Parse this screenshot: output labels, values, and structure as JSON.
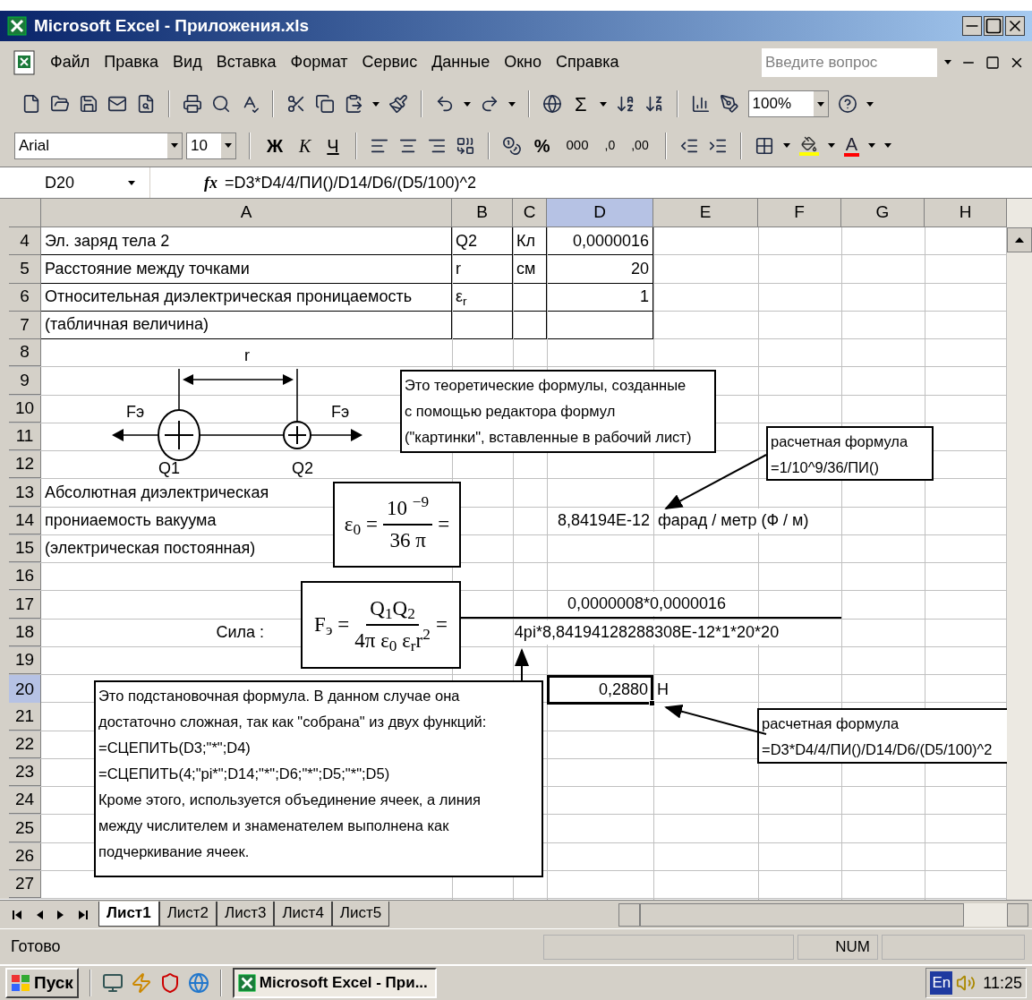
{
  "window": {
    "title": "Microsoft Excel - Приложения.xls"
  },
  "menu": [
    "Файл",
    "Правка",
    "Вид",
    "Вставка",
    "Формат",
    "Сервис",
    "Данные",
    "Окно",
    "Справка"
  ],
  "question_field": {
    "placeholder": "Введите вопрос"
  },
  "standard_toolbar": {
    "sum": "Σ",
    "zoom": "100%"
  },
  "format_toolbar": {
    "font": "Arial",
    "size": "10",
    "bold": "Ж",
    "italic": "К",
    "underline": "Ч",
    "percent": "%",
    "thousands": "000",
    "decimals": [
      ",0",
      ",00"
    ],
    "font_color": "A"
  },
  "formula_bar": {
    "name_box": "D20",
    "fx": "fx",
    "formula": "=D3*D4/4/ПИ()/D14/D6/(D5/100)^2"
  },
  "columns": [
    {
      "label": "A",
      "selected": false
    },
    {
      "label": "B",
      "selected": false
    },
    {
      "label": "C",
      "selected": false
    },
    {
      "label": "D",
      "selected": true
    },
    {
      "label": "E",
      "selected": false
    },
    {
      "label": "F",
      "selected": false
    },
    {
      "label": "G",
      "selected": false
    },
    {
      "label": "H",
      "selected": false
    }
  ],
  "rows": [
    {
      "number": "4",
      "selected": false,
      "boxed": true,
      "cells": {
        "A": {
          "text": "Эл. заряд тела 2",
          "kind": "text"
        },
        "B": {
          "text": "Q2",
          "kind": "text"
        },
        "C": {
          "text": "Кл",
          "kind": "text"
        },
        "D": {
          "text": "0,0000016",
          "kind": "number"
        }
      }
    },
    {
      "number": "5",
      "selected": false,
      "boxed": true,
      "cells": {
        "A": {
          "text": "Расстояние между точками",
          "kind": "text"
        },
        "B": {
          "text": "r",
          "kind": "text"
        },
        "C": {
          "text": "см",
          "kind": "text"
        },
        "D": {
          "text": "20",
          "kind": "number"
        }
      }
    },
    {
      "number": "6",
      "selected": false,
      "boxed": true,
      "cells": {
        "A": {
          "text": "Относительная диэлектрическая проницаемость",
          "kind": "text"
        },
        "B": {
          "text": "ε$_{r}$",
          "kind": "text"
        },
        "D": {
          "text": "1",
          "kind": "number"
        }
      }
    },
    {
      "number": "7",
      "selected": false,
      "boxed": true,
      "cells": {
        "A": {
          "text": "(табличная величина)",
          "kind": "text"
        }
      }
    },
    {
      "number": "8",
      "selected": false,
      "boxed": false,
      "cells": {}
    },
    {
      "number": "9",
      "selected": false,
      "boxed": false,
      "cells": {}
    },
    {
      "number": "10",
      "selected": false,
      "boxed": false,
      "cells": {}
    },
    {
      "number": "11",
      "selected": false,
      "boxed": false,
      "cells": {}
    },
    {
      "number": "12",
      "selected": false,
      "boxed": false,
      "cells": {}
    },
    {
      "number": "13",
      "selected": false,
      "boxed": false,
      "cells": {
        "A": {
          "text": "Абсолютная диэлектрическая",
          "kind": "text"
        }
      }
    },
    {
      "number": "14",
      "selected": false,
      "boxed": false,
      "cells": {
        "A": {
          "text": "прониаемость вакуума",
          "kind": "text"
        },
        "D": {
          "text": "8,84194E-12",
          "kind": "number"
        },
        "E": {
          "text": "фарад / метр (Ф / м)",
          "kind": "overflow"
        }
      }
    },
    {
      "number": "15",
      "selected": false,
      "boxed": false,
      "cells": {
        "A": {
          "text": "(электрическая постоянная)",
          "kind": "text"
        }
      }
    },
    {
      "number": "16",
      "selected": false,
      "boxed": false,
      "cells": {}
    },
    {
      "number": "17",
      "selected": false,
      "boxed": false,
      "cells": {
        "B": {
          "text": "0,0000008*0,0000016",
          "kind": "fraction-top"
        }
      }
    },
    {
      "number": "18",
      "selected": false,
      "boxed": false,
      "cells": {
        "A": {
          "text": "Сила :",
          "kind": "label"
        },
        "B": {
          "text": "4pi*8,84194128288308E-12*1*20*20",
          "kind": "merged"
        }
      }
    },
    {
      "number": "19",
      "selected": false,
      "boxed": false,
      "cells": {}
    },
    {
      "number": "20",
      "selected": true,
      "boxed": false,
      "cells": {
        "D": {
          "text": "0,2880",
          "kind": "number"
        },
        "E": {
          "text": "Н",
          "kind": "text"
        }
      }
    },
    {
      "number": "21",
      "selected": false,
      "boxed": false,
      "cells": {}
    },
    {
      "number": "22",
      "selected": false,
      "boxed": false,
      "cells": {}
    },
    {
      "number": "23",
      "selected": false,
      "boxed": false,
      "cells": {}
    },
    {
      "number": "24",
      "selected": false,
      "boxed": false,
      "cells": {}
    },
    {
      "number": "25",
      "selected": false,
      "boxed": false,
      "cells": {}
    },
    {
      "number": "26",
      "selected": false,
      "boxed": false,
      "cells": {}
    },
    {
      "number": "27",
      "selected": false,
      "boxed": false,
      "cells": {}
    }
  ],
  "diagram": {
    "distance_label": "r",
    "force_labels": [
      "Fэ",
      "Fэ"
    ],
    "charge_labels": [
      "Q1",
      "Q2"
    ]
  },
  "formulas": [
    {
      "lhs": "ε$_{0}$",
      "numerator": "10 $^{−9}$",
      "denominator": "36 π",
      "signs": [
        "=",
        "="
      ]
    },
    {
      "lhs": "F$_{э}$",
      "numerator": "Q$_{1}$Q$_{2}$",
      "denominator": "4π ε$_{0}$ ε$_{r}$r$^{2}$",
      "signs": [
        "=",
        "="
      ]
    }
  ],
  "notes": [
    {
      "lines": [
        "Это теоретические формулы, созданные",
        "с помощью редактора формул",
        "(\"картинки\", вставленные в рабочий лист)"
      ]
    },
    {
      "lines": [
        "расчетная формула",
        "=1/10^9/36/ПИ()"
      ]
    },
    {
      "lines": [
        "Это подстановочная формула. В данном случае она",
        "достаточно сложная, так как \"собрана\" из двух функций:",
        "=СЦЕПИТЬ(D3;\"*\";D4)",
        "=СЦЕПИТЬ(4;\"pi*\";D14;\"*\";D6;\"*\";D5;\"*\";D5)",
        "Кроме этого, используется объединение ячеек, а линия",
        "между числителем и знаменателем выполнена как",
        "подчеркивание ячеек."
      ]
    },
    {
      "lines": [
        "расчетная формула",
        "=D3*D4/4/ПИ()/D14/D6/(D5/100)^2"
      ]
    }
  ],
  "sheet_tabs": [
    {
      "label": "Лист1",
      "selected": true
    },
    {
      "label": "Лист2",
      "selected": false
    },
    {
      "label": "Лист3",
      "selected": false
    },
    {
      "label": "Лист4",
      "selected": false
    },
    {
      "label": "Лист5",
      "selected": false
    }
  ],
  "status_bar": {
    "text": "Готово",
    "num": "NUM"
  },
  "taskbar": {
    "start": "Пуск",
    "task": "Microsoft Excel - При...",
    "language": "En",
    "clock": "11:25"
  }
}
